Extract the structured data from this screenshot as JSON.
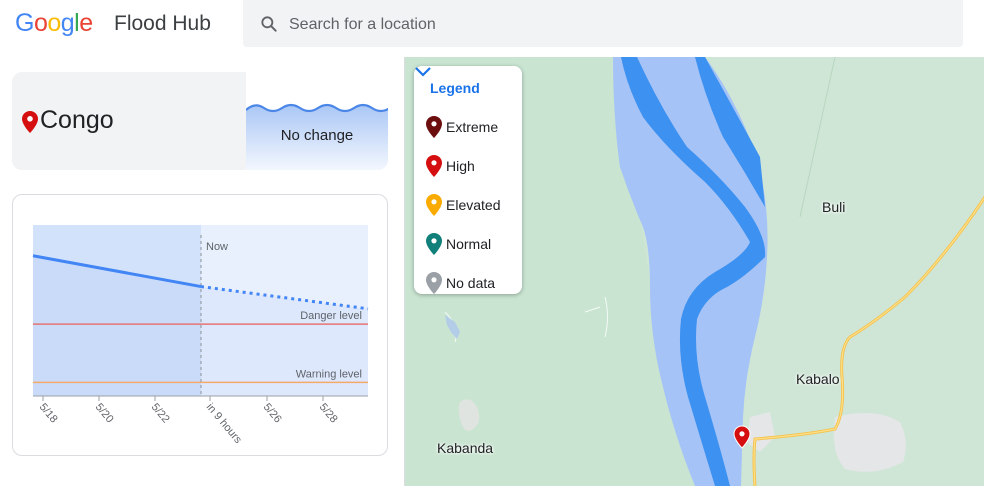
{
  "header": {
    "logo": [
      "G",
      "o",
      "o",
      "g",
      "l",
      "e"
    ],
    "logo_colors": [
      "#4285F4",
      "#EA4335",
      "#FBBC05",
      "#4285F4",
      "#34A853",
      "#EA4335"
    ],
    "product": "Flood Hub",
    "search_placeholder": "Search for a location"
  },
  "location": {
    "name": "Congo",
    "status": "No change"
  },
  "chart": {
    "now_label": "Now",
    "danger_label": "Danger level",
    "warning_label": "Warning level",
    "x_ticks": [
      "5/18",
      "5/20",
      "5/22",
      "in 9 hours",
      "5/26",
      "5/28"
    ]
  },
  "chart_data": {
    "type": "area",
    "x": [
      "5/17",
      "5/24 now",
      "5/30"
    ],
    "series": [
      {
        "name": "",
        "style": "solid",
        "values": [
          0.82,
          0.64
        ]
      },
      {
        "name": "",
        "style": "dotted",
        "values": [
          0.64,
          0.51
        ]
      }
    ],
    "danger_level": 0.42,
    "warning_level": 0.08,
    "ylim": [
      0,
      1
    ]
  },
  "legend": {
    "title": "Legend",
    "items": [
      {
        "label": "Extreme",
        "color": "#6d0e0e"
      },
      {
        "label": "High",
        "color": "#d50f0f"
      },
      {
        "label": "Elevated",
        "color": "#f9ab00"
      },
      {
        "label": "Normal",
        "color": "#12807a"
      },
      {
        "label": "No data",
        "color": "#9aa0a6"
      }
    ]
  },
  "map": {
    "places": [
      "Buli",
      "Kabalo",
      "Kabanda"
    ],
    "river_color": "#3d91f0",
    "flood_color": "#a5c3f7",
    "land_color": "#cfe6d6",
    "road_color": "#f6c14b"
  }
}
